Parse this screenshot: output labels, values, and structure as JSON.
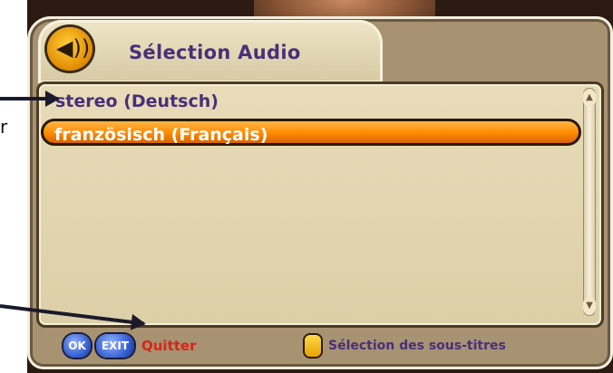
{
  "panel": {
    "title": "Sélection Audio",
    "speaker_icon_glyph": "◀))"
  },
  "audio_list": {
    "items": [
      {
        "label": "stereo (Deutsch)",
        "selected": false
      },
      {
        "label": "französisch (Français)",
        "selected": true
      }
    ],
    "scroll_up_glyph": "▲",
    "scroll_down_glyph": "▼"
  },
  "footer": {
    "ok_label": "OK",
    "exit_label": "EXIT",
    "quit_label": "Quitter",
    "subtitles_label": "Sélection des sous-titres"
  },
  "annotation": {
    "side_char": "r"
  },
  "colors": {
    "title_text": "#4a2f7a",
    "highlight": "#ff8a00",
    "quit_text": "#d6261a",
    "panel_bg": "#a79272",
    "key_blue": "#2c56c8",
    "key_yellow": "#ffd84a"
  }
}
